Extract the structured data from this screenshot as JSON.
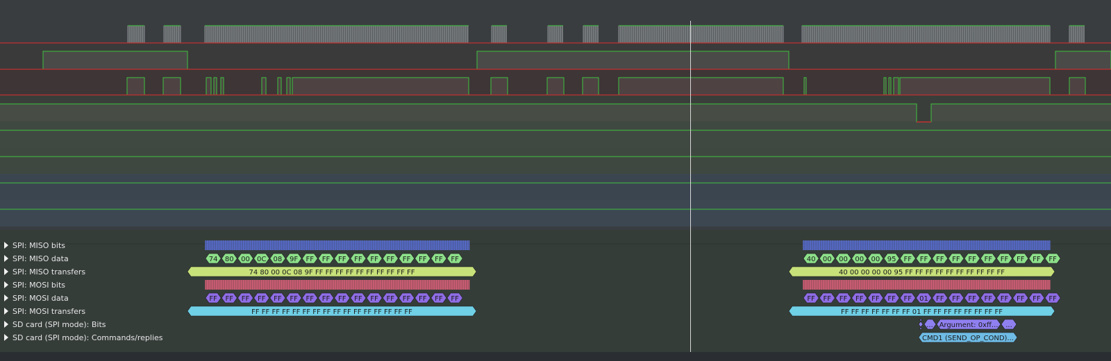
{
  "decoder_rows": [
    {
      "label": "SPI: MISO bits"
    },
    {
      "label": "SPI: MISO data"
    },
    {
      "label": "SPI: MISO transfers"
    },
    {
      "label": "SPI: MOSI bits"
    },
    {
      "label": "SPI: MOSI data"
    },
    {
      "label": "SPI: MOSI transfers"
    },
    {
      "label": "SD card (SPI mode): Bits"
    },
    {
      "label": "SD card (SPI mode): Commands/replies"
    }
  ],
  "miso_data": {
    "bytes_a": [
      "74",
      "80",
      "00",
      "0C",
      "08",
      "9F",
      "FF",
      "FF",
      "FF",
      "FF",
      "FF",
      "FF",
      "FF",
      "FF",
      "FF",
      "FF"
    ],
    "bytes_b": [
      "40",
      "00",
      "00",
      "00",
      "00",
      "95",
      "FF",
      "FF",
      "FF",
      "FF",
      "FF",
      "FF",
      "FF",
      "FF",
      "FF",
      "FF"
    ]
  },
  "miso_transfers": {
    "a": "74 80 00 0C 08 9F FF FF FF FF FF FF FF FF FF FF",
    "b": "40 00 00 00 00 95 FF FF FF FF FF FF FF FF FF FF"
  },
  "mosi_data": {
    "bytes_a": [
      "FF",
      "FF",
      "FF",
      "FF",
      "FF",
      "FF",
      "FF",
      "FF",
      "FF",
      "FF",
      "FF",
      "FF",
      "FF",
      "FF",
      "FF",
      "FF"
    ],
    "bytes_b": [
      "FF",
      "FF",
      "FF",
      "FF",
      "FF",
      "FF",
      "FF",
      "01",
      "FF",
      "FF",
      "FF",
      "FF",
      "FF",
      "FF",
      "FF",
      "FF"
    ]
  },
  "mosi_transfers": {
    "a": "FF FF FF FF FF FF FF FF FF FF FF FF FF FF FF FF",
    "b": "FF FF FF FF FF FF FF 01 FF FF FF FF FF FF FF FF"
  },
  "sd_bits": {
    "dots1": "...",
    "argument": "Argument: 0xff...",
    "dots2": "..."
  },
  "sd_command": "CMD1 (SEND_OP_COND)...",
  "colors": {
    "miso_bits": "#5a6fd8",
    "miso_data": "#8de08a",
    "miso_transfers": "#c8e27a",
    "mosi_bits": "#e0607a",
    "mosi_data": "#8f6de6",
    "mosi_transfers": "#6fd0e6",
    "sd_bits": "#8f80f0",
    "sd_command": "#6fbce6",
    "logic_high": "#3fc23f",
    "logic_low": "#c03030",
    "cursor": "#d8d8d8"
  }
}
